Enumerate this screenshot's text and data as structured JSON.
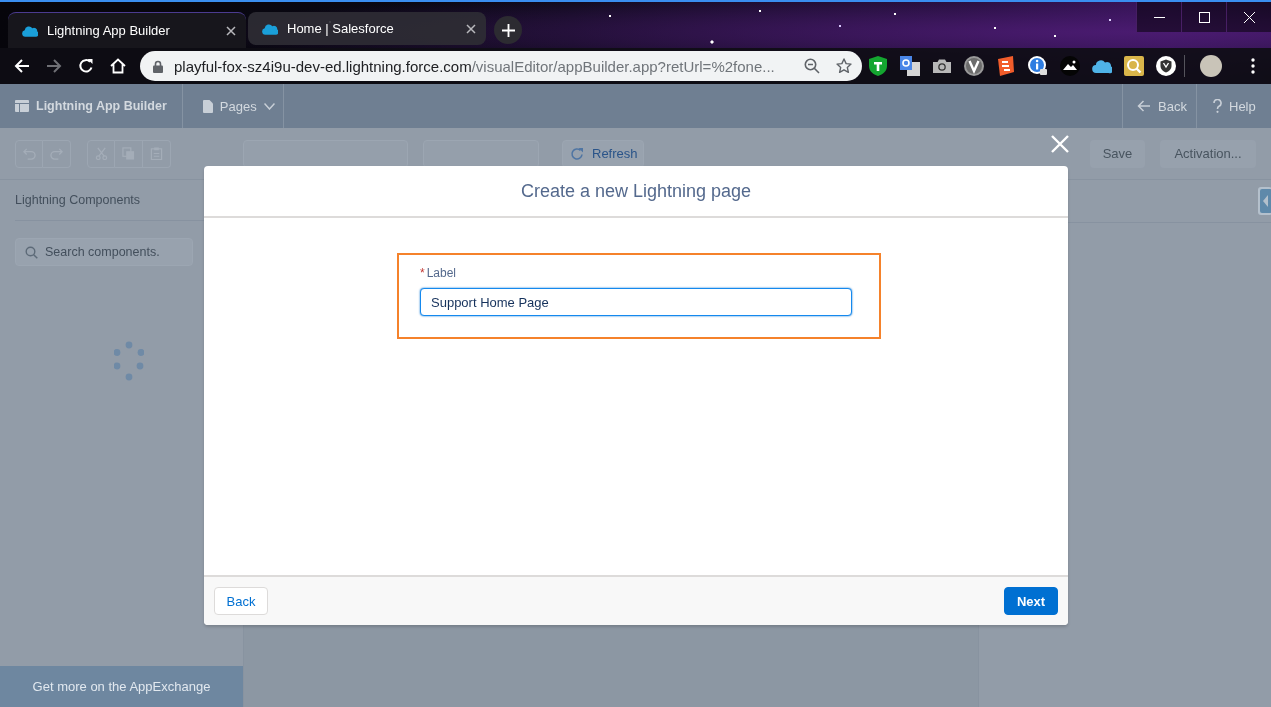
{
  "browser": {
    "tabs": [
      {
        "title": "Lightning App Builder",
        "selected": true
      },
      {
        "title": "Home | Salesforce",
        "selected": false
      }
    ],
    "forward": {
      "disabled": true
    },
    "address": {
      "host": "playful-fox-sz4i9u-dev-ed.lightning.force.com",
      "path": "/visualEditor/appBuilder.app?retUrl=%2fone..."
    }
  },
  "app_header": {
    "title": "Lightning App Builder",
    "menu": "Pages",
    "back": "Back",
    "help": "Help"
  },
  "toolbar": {
    "refresh": {
      "label": "Refresh",
      "disabled": false
    },
    "actions": [
      {
        "label": "Save",
        "disabled": true
      },
      {
        "label": "Activation...",
        "disabled": true
      }
    ]
  },
  "components_panel": {
    "heading": "Lightning Components",
    "search": {
      "placeholder": "Search components."
    },
    "footer_link": "Get more on the AppExchange"
  },
  "modal": {
    "title": "Create a new Lightning page",
    "field": {
      "required_mark": "*",
      "label": "Label",
      "value": "Support Home Page"
    },
    "buttons": [
      {
        "label": "Back",
        "kind": "neutral"
      },
      {
        "label": "Next",
        "kind": "brand"
      }
    ]
  }
}
